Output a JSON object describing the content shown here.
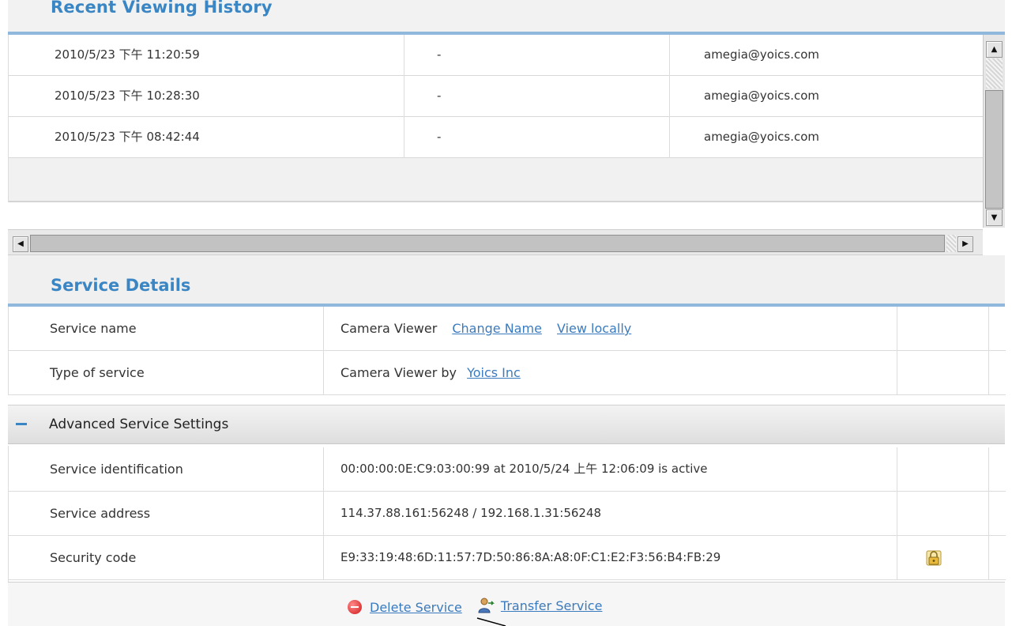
{
  "recent_history": {
    "title": "Recent Viewing History",
    "rows": [
      {
        "time": "2010/5/23 下午 11:20:59",
        "location": "-",
        "user": "amegia@yoics.com"
      },
      {
        "time": "2010/5/23 下午 10:28:30",
        "location": "-",
        "user": "amegia@yoics.com"
      },
      {
        "time": "2010/5/23 下午 08:42:44",
        "location": "-",
        "user": "amegia@yoics.com"
      }
    ]
  },
  "service_details": {
    "title": "Service Details",
    "service_name_label": "Service name",
    "service_name_value": "Camera Viewer",
    "change_name_link": "Change Name",
    "view_locally_link": "View locally",
    "type_label": "Type of service",
    "type_value": "Camera Viewer by",
    "type_vendor_link": "Yoics Inc"
  },
  "advanced": {
    "title": "Advanced Service Settings",
    "toggle_symbol": "−",
    "identification_label": "Service identification",
    "identification_value": "00:00:00:0E:C9:03:00:99 at  2010/5/24 上午 12:06:09 is  active",
    "address_label": "Service address",
    "address_value": "114.37.88.161:56248 / 192.168.1.31:56248",
    "security_label": "Security code",
    "security_value": "E9:33:19:48:6D:11:57:7D:50:86:8A:A8:0F:C1:E2:F3:56:B4:FB:29"
  },
  "actions": {
    "delete_label": "Delete Service",
    "transfer_label": "Transfer Service"
  },
  "colors": {
    "accent": "#3a86c4",
    "link": "#3a7bbf",
    "delete": "#d01818"
  },
  "icons": {
    "delete": "delete-icon",
    "transfer": "transfer-user-icon",
    "security": "lock-icon"
  }
}
